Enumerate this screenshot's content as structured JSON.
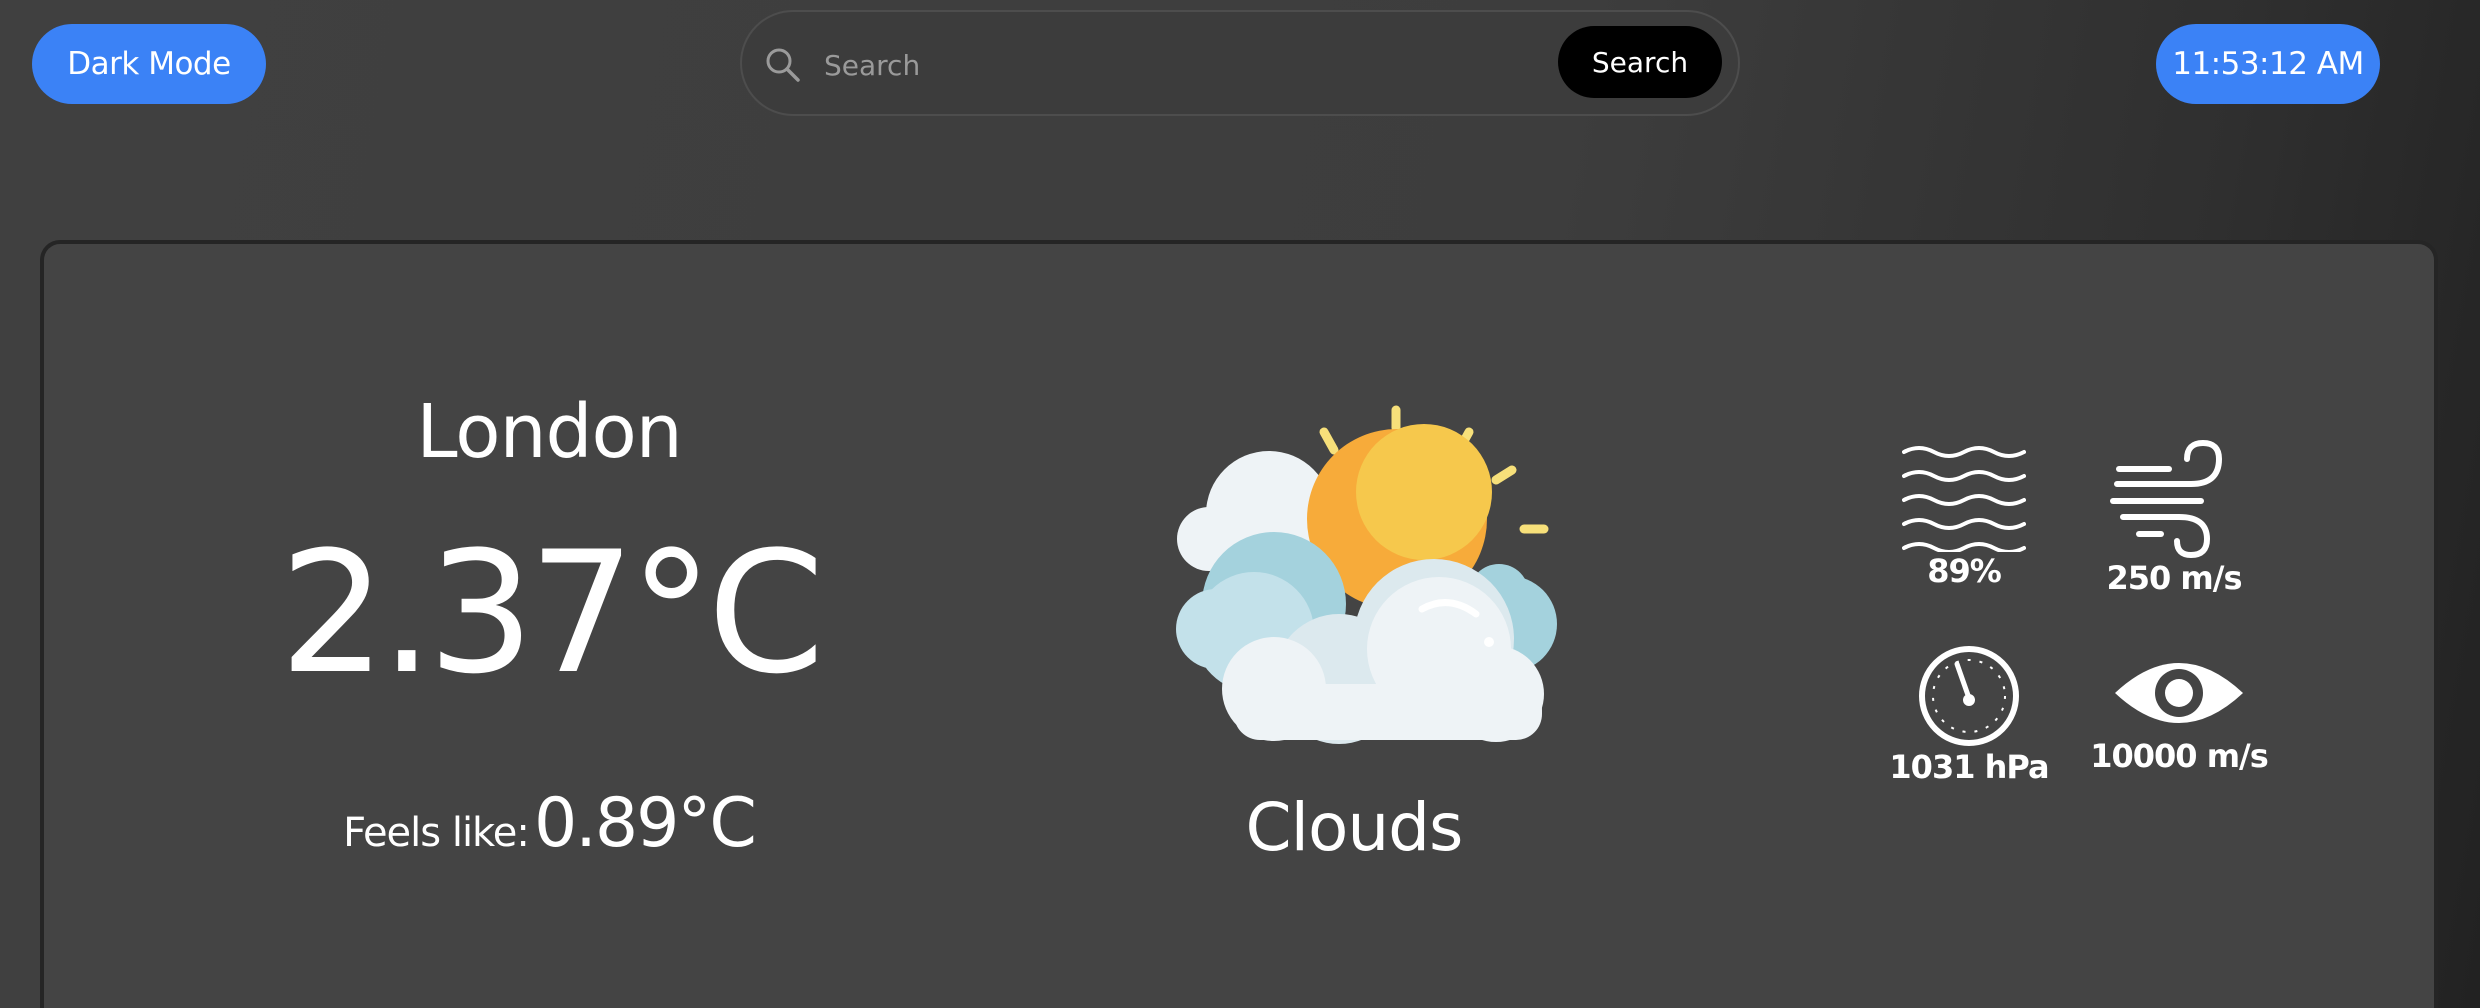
{
  "header": {
    "theme_toggle_label": "Dark Mode",
    "search": {
      "placeholder": "Search",
      "value": "",
      "button_label": "Search"
    },
    "clock": "11:53:12 AM"
  },
  "weather": {
    "city": "London",
    "temperature": "2.37°C",
    "feels_like_label": "Feels like:",
    "feels_like_value": "0.89°C",
    "condition": "Clouds",
    "condition_icon": "sun-behind-clouds-icon",
    "stats": {
      "humidity": {
        "icon": "humidity-waves-icon",
        "value": "89%"
      },
      "wind": {
        "icon": "wind-icon",
        "value": "250 m/s"
      },
      "pressure": {
        "icon": "pressure-gauge-icon",
        "value": "1031 hPa"
      },
      "visibility": {
        "icon": "eye-icon",
        "value": "10000 m/s"
      }
    }
  },
  "colors": {
    "accent": "#3b82f6",
    "card_background": "#444444",
    "search_button": "#000000",
    "sun": "#f7b035",
    "cloud": "#eef3f6"
  }
}
